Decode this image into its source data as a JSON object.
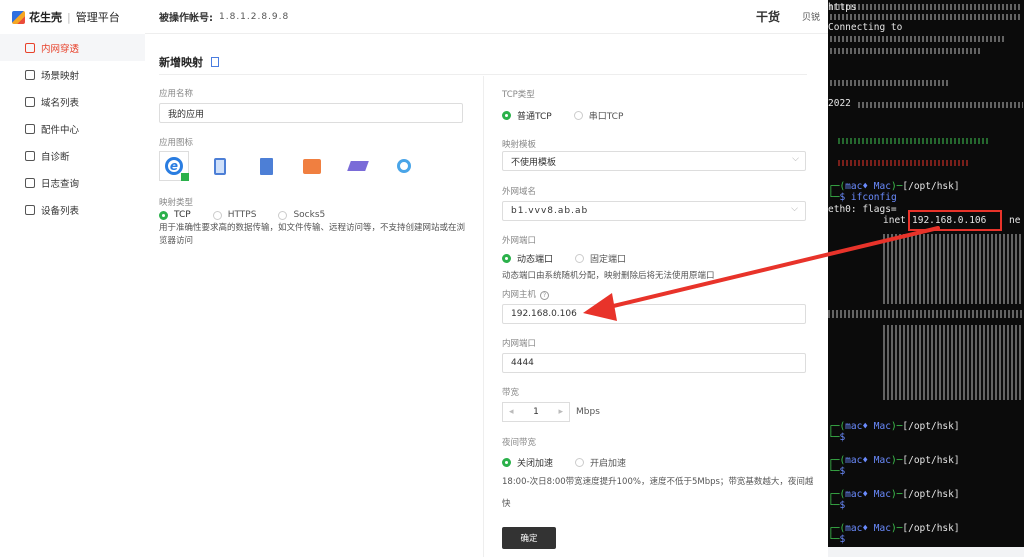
{
  "sidebar": {
    "brand": "花生壳",
    "platform": "管理平台",
    "items": [
      {
        "label": "内网穿透",
        "active": true
      },
      {
        "label": "场景映射"
      },
      {
        "label": "域名列表"
      },
      {
        "label": "配件中心"
      },
      {
        "label": "自诊断"
      },
      {
        "label": "日志查询"
      },
      {
        "label": "设备列表"
      }
    ]
  },
  "header": {
    "account_label": "被操作帐号:",
    "account_value": "1.8.1.2.8.9.8",
    "brand": "干货",
    "user": "贝锐"
  },
  "form": {
    "title": "新增映射",
    "app_name_label": "应用名称",
    "app_name_value": "我的应用",
    "app_icon_label": "应用图标",
    "map_type_label": "映射类型",
    "map_types": [
      "TCP",
      "HTTPS",
      "Socks5"
    ],
    "map_type_hint": "用于准确性要求高的数据传输，如文件传输、远程访问等，不支持创建网站或在浏览器访问",
    "tcp_type_label": "TCP类型",
    "tcp_types": [
      "普通TCP",
      "串口TCP"
    ],
    "template_label": "映射模板",
    "template_value": "不使用模板",
    "domain_label": "外网域名",
    "domain_value": "b1.vvv8.ab.ab",
    "port_label": "外网端口",
    "port_types": [
      "动态端口",
      "固定端口"
    ],
    "port_hint": "动态端口由系统随机分配，映射删除后将无法使用原端口",
    "host_label": "内网主机",
    "host_value": "192.168.0.106",
    "inner_port_label": "内网端口",
    "inner_port_value": "4444",
    "bandwidth_label": "带宽",
    "bandwidth_value": "1",
    "bandwidth_unit": "Mbps",
    "night_label": "夜间带宽",
    "night_options": [
      "关闭加速",
      "开启加速"
    ],
    "night_hint_1": "18:00-次日8:00带宽速度提升100%，速度不低于5Mbps；带宽基数越大，夜间越",
    "night_hint_2": "快",
    "submit": "确定"
  },
  "terminal": {
    "prompt_user": "mac♦ Mac",
    "prompt_path": "[/opt/hsk]",
    "cmd": "ifconfig",
    "iface": "eth0: flags=",
    "ip": "192.168.0.106",
    "connecting": "Connecting to",
    "year": "2022",
    "https": "https",
    "inet": "inet",
    "ne": "ne",
    "dollar": "$"
  }
}
